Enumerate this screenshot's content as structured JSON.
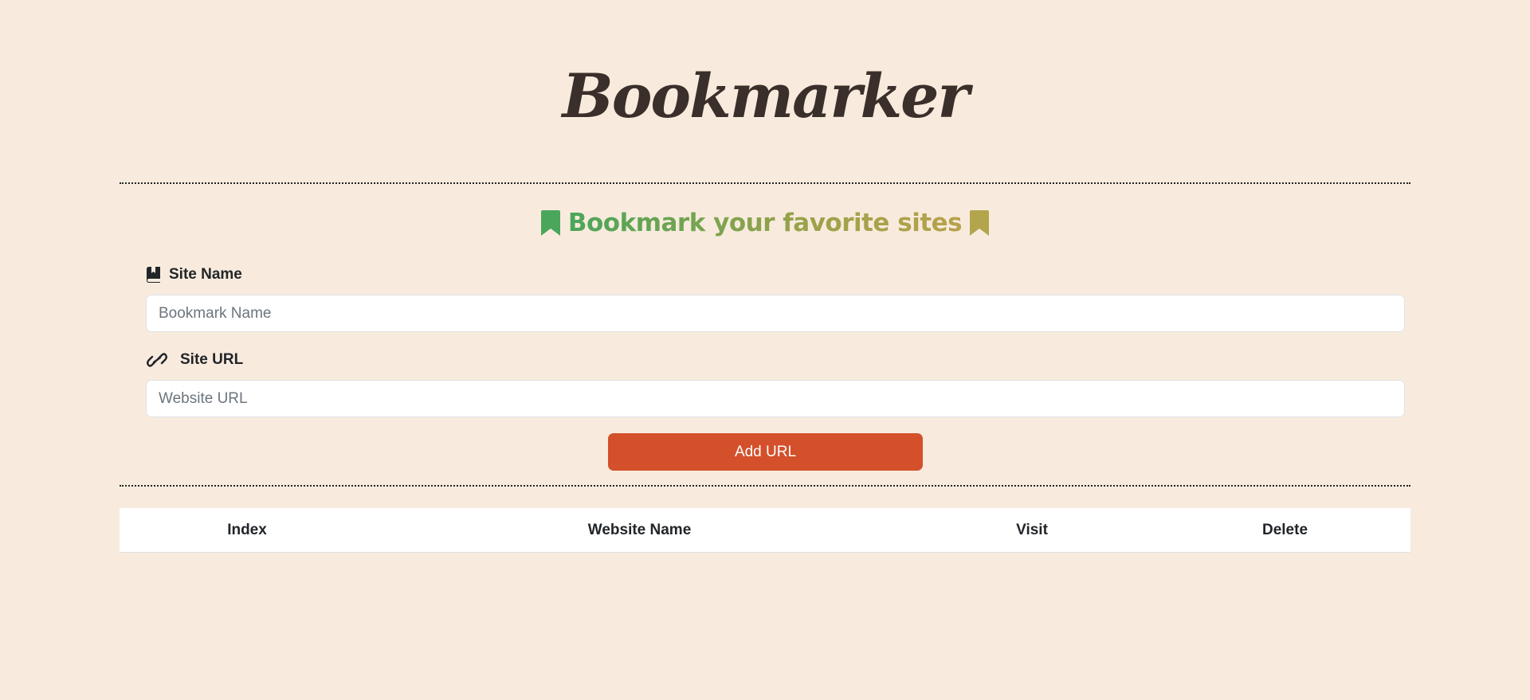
{
  "header": {
    "title": "Bookmarker"
  },
  "form": {
    "heading": "Bookmark your favorite sites",
    "site_name_label": "Site Name",
    "site_name_placeholder": "Bookmark Name",
    "site_name_value": "",
    "site_url_label": "Site URL",
    "site_url_placeholder": "Website URL",
    "site_url_value": "",
    "submit_label": "Add URL"
  },
  "table": {
    "columns": [
      "Index",
      "Website Name",
      "Visit",
      "Delete"
    ],
    "rows": []
  },
  "colors": {
    "background": "#f8ebdd",
    "title_highlight": "#fec260",
    "heading_green": "#4aa65a",
    "heading_olive": "#b8a24c",
    "button": "#d3502b"
  }
}
